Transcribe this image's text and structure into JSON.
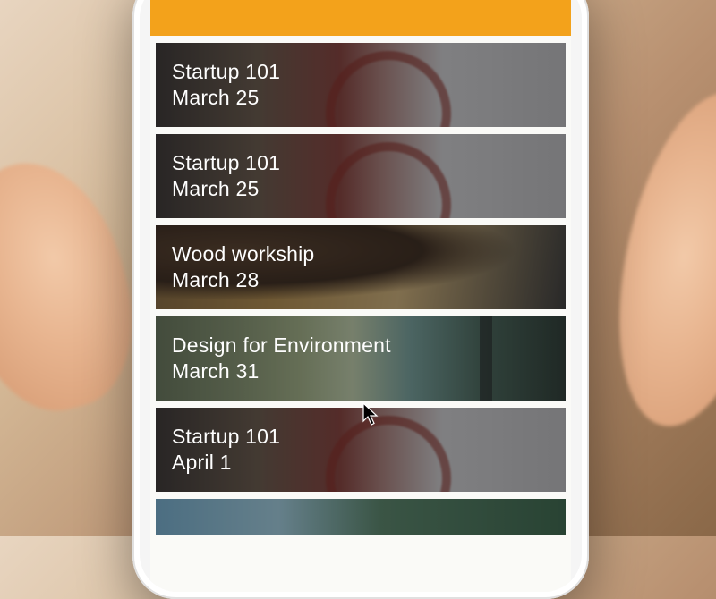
{
  "header": {},
  "events": [
    {
      "title": "Startup 101",
      "date": "March 25"
    },
    {
      "title": "Startup 101",
      "date": "March 25"
    },
    {
      "title": "Wood workship",
      "date": "March 28"
    },
    {
      "title": "Design for Environment",
      "date": "March 31"
    },
    {
      "title": "Startup 101",
      "date": "April 1"
    }
  ]
}
